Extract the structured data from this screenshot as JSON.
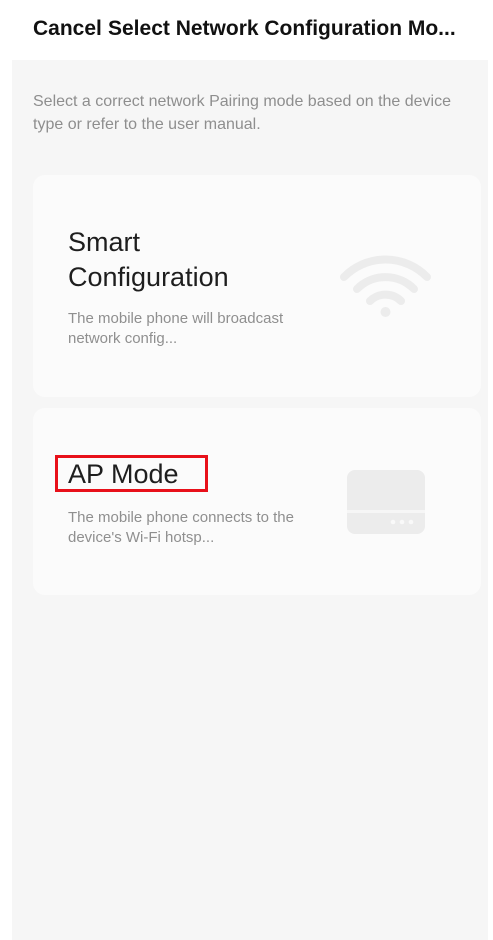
{
  "header": {
    "cancel_label": "Cancel",
    "title": "Select Network Configuration Mo..."
  },
  "instructions": "Select a correct network Pairing mode based on the device type or refer to the user manual.",
  "modes": [
    {
      "title": "Smart Configuration",
      "description": "The mobile phone will broadcast network config...",
      "icon": "wifi-icon"
    },
    {
      "title": "AP Mode",
      "description": "The mobile phone connects to the device's Wi-Fi hotsp...",
      "icon": "router-icon"
    }
  ],
  "colors": {
    "background": "#f6f6f6",
    "card": "#fbfbfb",
    "highlight": "#e8101a",
    "secondary_text": "#8f8f8f"
  }
}
